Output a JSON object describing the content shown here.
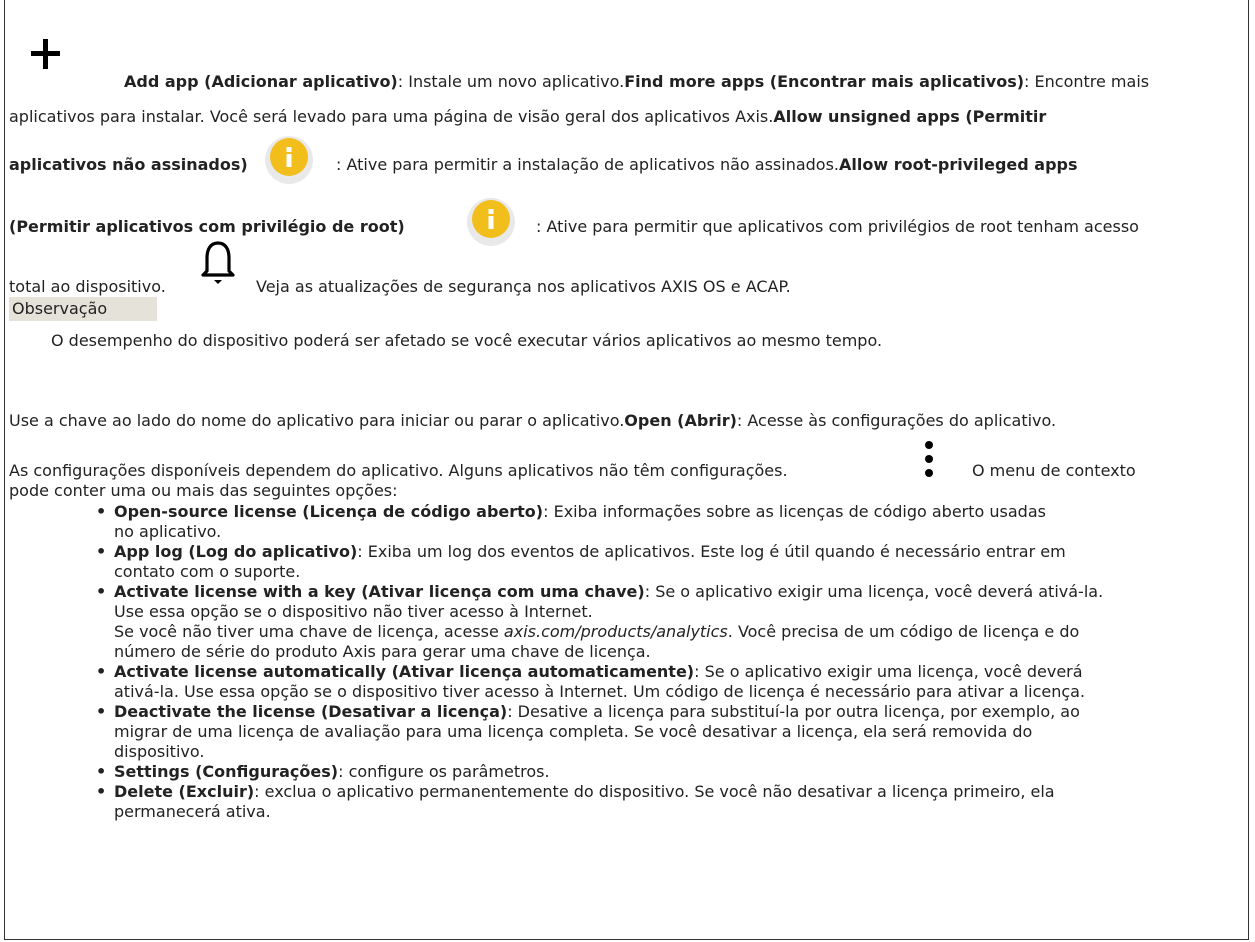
{
  "p1": {
    "l1_a": "Add app (Adicionar aplicativo)",
    "l1_b": ": Instale um novo aplicativo.",
    "l1_c": "Find more apps (Encontrar mais aplicativos)",
    "l1_d": ": Encontre mais",
    "l2_a": "aplicativos para instalar. Você será levado para uma página de visão geral dos aplicativos Axis.",
    "l2_b": "Allow unsigned apps (Permitir",
    "l3_a": "aplicativos não assinados)",
    "l3_b": ": Ative para permitir a instalação de aplicativos não assinados.",
    "l3_c": "Allow root-privileged apps",
    "l4_a": "(Permitir aplicativos com privilégio de root)",
    "l4_b": ": Ative para permitir que aplicativos com privilégios de root tenham acesso",
    "l5_a": "total ao dispositivo.",
    "l5_b": "Veja as atualizações de segurança nos aplicativos AXIS OS e ACAP."
  },
  "note": {
    "label": "Observação",
    "text": "O desempenho do dispositivo poderá ser afetado se você executar vários aplicativos ao mesmo tempo."
  },
  "p2": {
    "l1_a": "Use a chave ao lado do nome do aplicativo para iniciar ou parar o aplicativo.",
    "l1_b": "Open (Abrir)",
    "l1_c": ": Acesse às configurações do aplicativo.",
    "l2_a": "As configurações disponíveis dependem do aplicativo. Alguns aplicativos não têm configurações.",
    "l2_b": "O menu de contexto",
    "l3": "pode conter uma ou mais das seguintes opções:"
  },
  "options": [
    {
      "title": "Open-source license (Licença de código aberto)",
      "l1": ": Exiba informações sobre as licenças de código aberto usadas",
      "l2": "no aplicativo."
    },
    {
      "title": "App log (Log do aplicativo)",
      "l1": ": Exiba um log dos eventos de aplicativos. Este log é útil quando é necessário entrar em",
      "l2": "contato com o suporte."
    },
    {
      "title": "Activate license with a key (Ativar licença com uma chave)",
      "l1": ": Se o aplicativo exigir uma licença, você deverá ativá-la.",
      "l2": "Use essa opção se o dispositivo não tiver acesso à Internet.",
      "l3_a": "Se você não tiver uma chave de licença, acesse ",
      "l3_link": "axis.com/products/analytics",
      "l3_b": ". Você precisa de um código de licença e do",
      "l4": "número de série do produto Axis para gerar uma chave de licença."
    },
    {
      "title": "Activate license automatically (Ativar licença automaticamente)",
      "l1": ": Se o aplicativo exigir uma licença, você deverá",
      "l2": "ativá-la. Use essa opção se o dispositivo tiver acesso à Internet. Um código de licença é necessário para ativar a licença."
    },
    {
      "title": "Deactivate the license (Desativar a licença)",
      "l1": ": Desative a licença para substituí-la por outra licença, por exemplo, ao",
      "l2": "migrar de uma licença de avaliação para uma licença completa. Se você desativar a licença, ela será removida do",
      "l3": "dispositivo."
    },
    {
      "title": "Settings (Configurações)",
      "l1": ": configure os parâmetros."
    },
    {
      "title": "Delete (Excluir)",
      "l1": ": exclua o aplicativo permanentemente do dispositivo. Se você não desativar a licença primeiro, ela",
      "l2": "permanecerá ativa."
    }
  ],
  "colors": {
    "info_icon": "#f2be1c",
    "note_bg": "#e5e2d9"
  }
}
